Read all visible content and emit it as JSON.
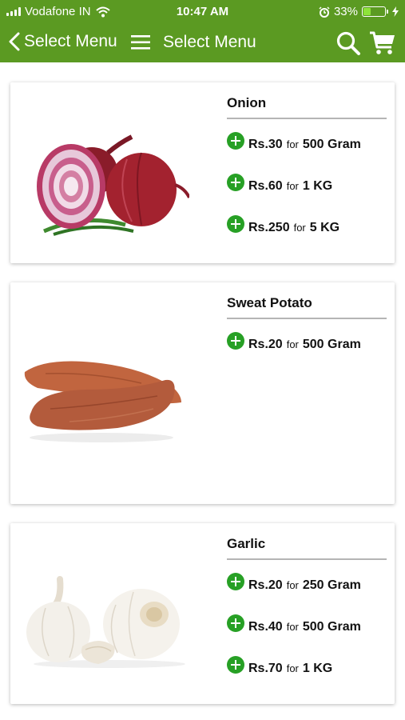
{
  "status_bar": {
    "carrier": "Vodafone IN",
    "time": "10:47 AM",
    "battery": "33%",
    "battery_level": 0.33
  },
  "nav": {
    "back_label": "Select Menu",
    "title": "Select Menu",
    "color": "#5b9a22"
  },
  "products": [
    {
      "name": "Onion",
      "options": [
        {
          "price": "Rs.30",
          "for": "for",
          "qty": "500 Gram"
        },
        {
          "price": "Rs.60",
          "for": "for",
          "qty": "1 KG"
        },
        {
          "price": "Rs.250",
          "for": "for",
          "qty": "5 KG"
        }
      ]
    },
    {
      "name": "Sweat Potato",
      "options": [
        {
          "price": "Rs.20",
          "for": "for",
          "qty": "500 Gram"
        }
      ]
    },
    {
      "name": "Garlic",
      "options": [
        {
          "price": "Rs.20",
          "for": "for",
          "qty": "250 Gram"
        },
        {
          "price": "Rs.40",
          "for": "for",
          "qty": "500 Gram"
        },
        {
          "price": "Rs.70",
          "for": "for",
          "qty": "1 KG"
        }
      ]
    }
  ],
  "accent_color": "#27a025"
}
